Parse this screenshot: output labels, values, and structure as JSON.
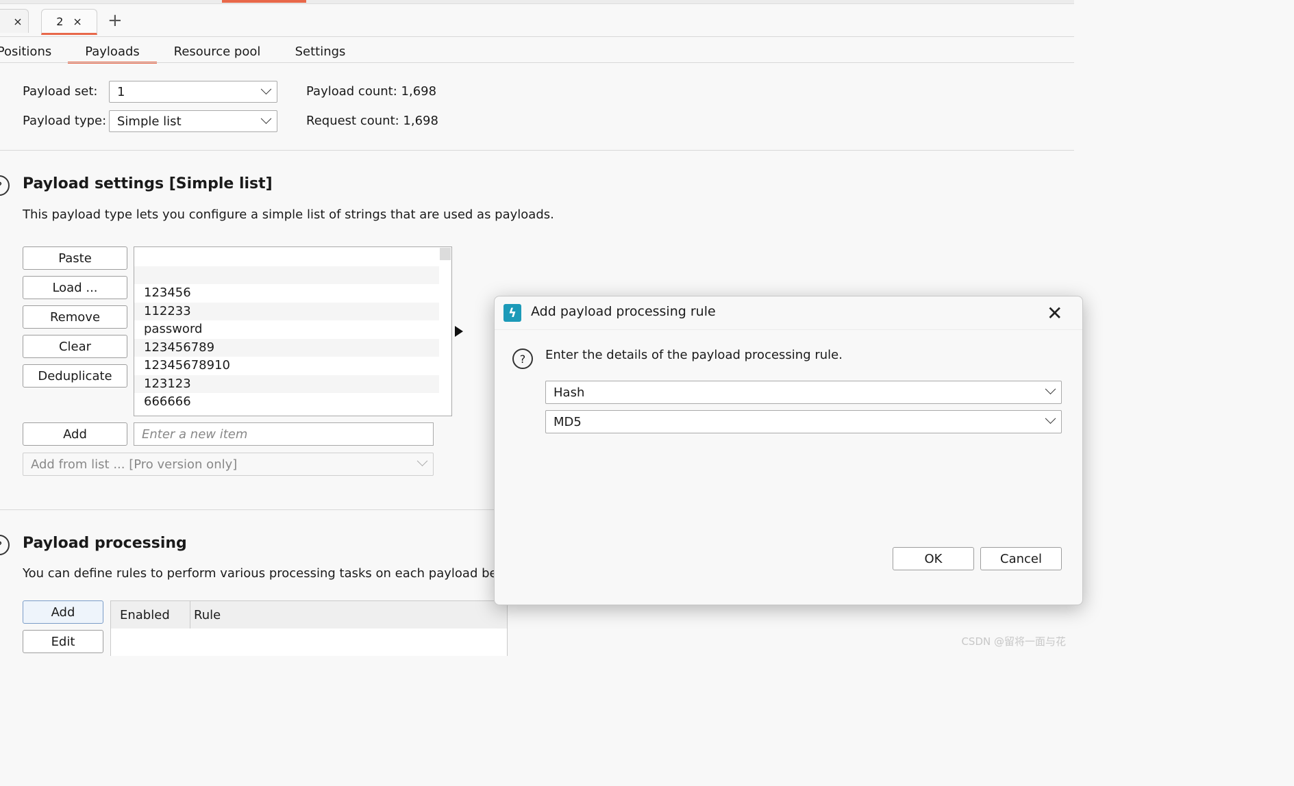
{
  "tabs": [
    {
      "label": "",
      "close": "×"
    },
    {
      "label": "2",
      "close": "×"
    }
  ],
  "new_tab_glyph": "+",
  "subtabs": [
    "Positions",
    "Payloads",
    "Resource pool",
    "Settings"
  ],
  "payload_set": {
    "label": "Payload set:",
    "value": "1"
  },
  "payload_type": {
    "label": "Payload type:",
    "value": "Simple list"
  },
  "payload_count": {
    "label": "Payload count:",
    "value": "1,698"
  },
  "request_count": {
    "label": "Request count:",
    "value": "1,698"
  },
  "settings_section": {
    "help_glyph": "?",
    "title": "Payload settings [Simple list]",
    "description": "This payload type lets you configure a simple list of strings that are used as payloads.",
    "buttons": {
      "paste": "Paste",
      "load": "Load ...",
      "remove": "Remove",
      "clear": "Clear",
      "deduplicate": "Deduplicate",
      "add": "Add"
    },
    "list_items": [
      "",
      "",
      "123456",
      "112233",
      "password",
      "123456789",
      "12345678910",
      "123123",
      "666666"
    ],
    "new_item_placeholder": "Enter a new item",
    "add_from_list": "Add from list ... [Pro version only]"
  },
  "processing_section": {
    "help_glyph": "?",
    "title": "Payload processing",
    "description": "You can define rules to perform various processing tasks on each payload befo",
    "buttons": {
      "add": "Add",
      "edit": "Edit"
    },
    "columns": [
      "Enabled",
      "Rule"
    ]
  },
  "dialog": {
    "title": "Add payload processing rule",
    "icon_glyph": "ϟ",
    "close_glyph": "✕",
    "help_glyph": "?",
    "prompt": "Enter the details of the payload processing rule.",
    "rule_type": "Hash",
    "algorithm": "MD5",
    "ok": "OK",
    "cancel": "Cancel"
  },
  "watermark": "CSDN @留将一面与花",
  "colors": {
    "accent": "#e8684a",
    "dialog_icon": "#1c9ab8"
  }
}
